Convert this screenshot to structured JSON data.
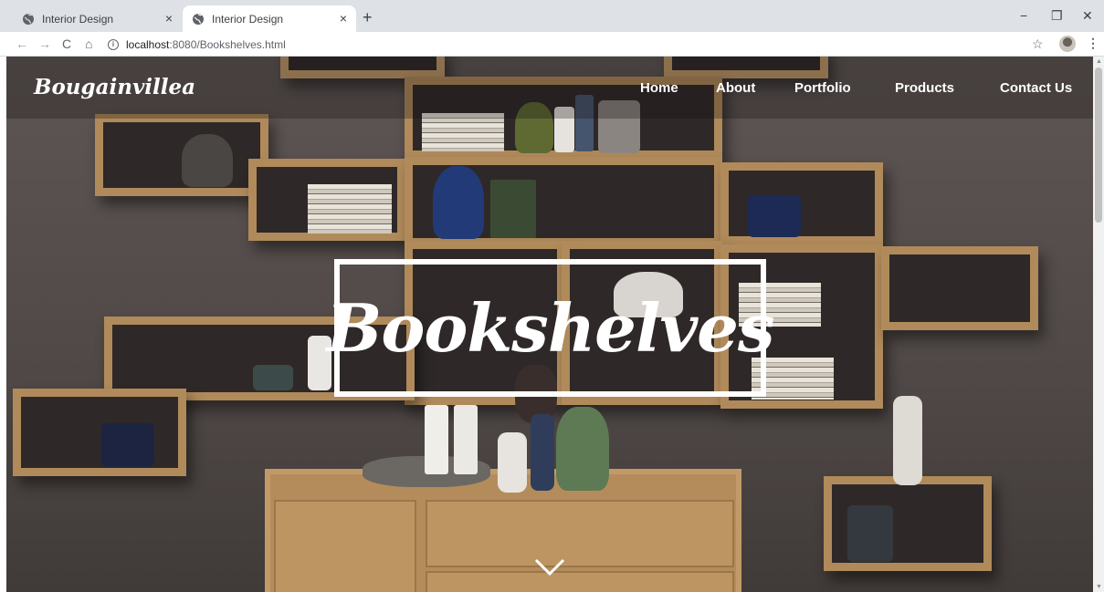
{
  "browser": {
    "tabs": [
      {
        "title": "Interior Design",
        "active": false,
        "close": "×"
      },
      {
        "title": "Interior Design",
        "active": true,
        "close": "×"
      }
    ],
    "new_tab": "+",
    "window_controls": {
      "minimize": "−",
      "restore": "❐",
      "close": "✕"
    },
    "nav": {
      "back": "←",
      "forward": "→",
      "reload": "C",
      "home": "⌂"
    },
    "url": {
      "host": "localhost",
      "path": ":8080/Bookshelves.html"
    },
    "bookmark": "☆",
    "menu": "⋮",
    "icons": [
      "globe-icon",
      "info-icon",
      "star-icon",
      "profile-avatar",
      "kebab-menu-icon"
    ]
  },
  "site": {
    "brand": "Bougainvillea",
    "nav": [
      "Home",
      "About",
      "Portfolio",
      "Products",
      "Contact Us"
    ],
    "hero_title": "Bookshelves",
    "scroll_icon": "chevron-down-icon"
  },
  "colors": {
    "tab_strip": "#dee1e6",
    "nav_text": "#ffffff",
    "title_border": "#ffffff",
    "wood": "#b08a5a",
    "wall": "#5e5654"
  }
}
